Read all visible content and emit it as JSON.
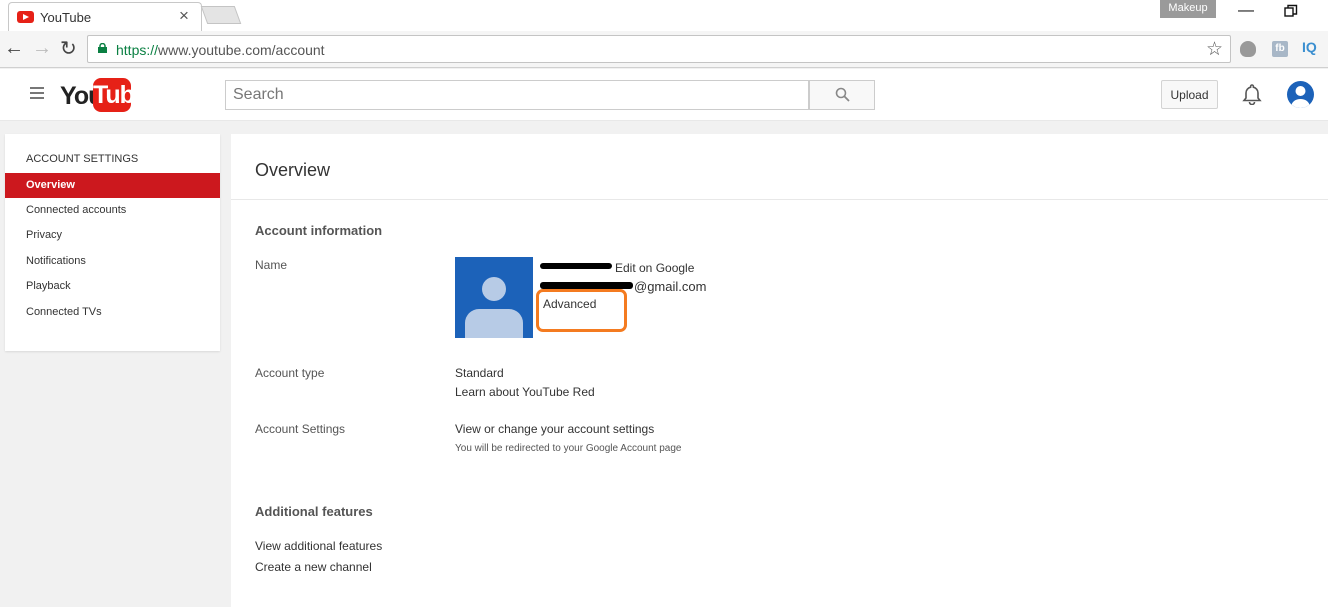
{
  "browser": {
    "tab_title": "YouTube",
    "profile_label": "Makeup",
    "url_scheme": "https://",
    "url_rest": "www.youtube.com/account",
    "extensions": [
      "shield-extension",
      "fb",
      "IQ"
    ]
  },
  "header": {
    "logo_you": "You",
    "logo_tube": "Tube",
    "search_placeholder": "Search",
    "upload_label": "Upload"
  },
  "sidebar": {
    "heading": "ACCOUNT SETTINGS",
    "items": [
      {
        "label": "Overview",
        "active": true
      },
      {
        "label": "Connected accounts",
        "active": false
      },
      {
        "label": "Privacy",
        "active": false
      },
      {
        "label": "Notifications",
        "active": false
      },
      {
        "label": "Playback",
        "active": false
      },
      {
        "label": "Connected TVs",
        "active": false
      }
    ]
  },
  "main": {
    "title": "Overview",
    "account_info": {
      "heading": "Account information",
      "name_label": "Name",
      "edit_link": "Edit on Google",
      "email_suffix": "@gmail.com",
      "advanced_link": "Advanced",
      "account_type_label": "Account type",
      "account_type_value": "Standard",
      "red_link": "Learn about YouTube Red",
      "settings_label": "Account Settings",
      "settings_link": "View or change your account settings",
      "settings_note": "You will be redirected to your Google Account page"
    },
    "additional": {
      "heading": "Additional features",
      "view_link": "View additional features",
      "create_link": "Create a new channel"
    }
  },
  "colors": {
    "youtube_red": "#e62117",
    "sidebar_active": "#cc181e",
    "link_blue": "#167ac6",
    "highlight_orange": "#f47b20",
    "avatar_blue": "#1c62b9"
  }
}
